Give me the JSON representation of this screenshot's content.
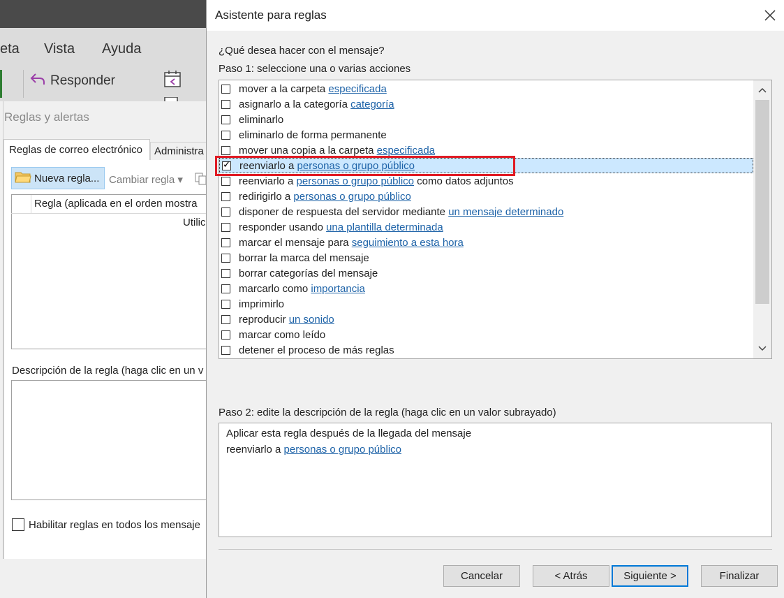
{
  "outlook": {
    "menu": [
      "eta",
      "Vista",
      "Ayuda"
    ],
    "reply_label": "Responder",
    "rules_window_title": "Reglas y alertas",
    "tabs": [
      "Reglas de correo electrónico",
      "Administra"
    ],
    "new_rule_label": "Nueva regla...",
    "change_rule_label": "Cambiar regla",
    "rule_column_header": "Regla (aplicada en el orden mostra",
    "utilic_text": "Utilic",
    "rule_description_label": "Descripción de la regla (haga clic en un v",
    "enable_rules_label": "Habilitar reglas en todos los mensaje"
  },
  "dialog": {
    "title": "Asistente para reglas",
    "question": "¿Qué desea hacer con el mensaje?",
    "step1": "Paso 1: seleccione una o varias acciones",
    "actions": [
      {
        "pre": "mover a la carpeta ",
        "link": "especificada",
        "post": "",
        "checked": false
      },
      {
        "pre": "asignarlo a la categoría ",
        "link": "categoría",
        "post": "",
        "checked": false
      },
      {
        "pre": "eliminarlo",
        "link": "",
        "post": "",
        "checked": false
      },
      {
        "pre": "eliminarlo de forma permanente",
        "link": "",
        "post": "",
        "checked": false
      },
      {
        "pre": "mover una copia a la carpeta ",
        "link": "especificada",
        "post": "",
        "checked": false
      },
      {
        "pre": "reenviarlo a ",
        "link": "personas o grupo público",
        "post": "",
        "checked": true
      },
      {
        "pre": "reenviarlo a ",
        "link": "personas o grupo público",
        "post": " como datos adjuntos",
        "checked": false
      },
      {
        "pre": "redirigirlo a ",
        "link": "personas o grupo público",
        "post": "",
        "checked": false
      },
      {
        "pre": "disponer de respuesta del servidor mediante ",
        "link": "un mensaje determinado",
        "post": "",
        "checked": false
      },
      {
        "pre": "responder usando ",
        "link": "una plantilla determinada",
        "post": "",
        "checked": false
      },
      {
        "pre": "marcar el mensaje para ",
        "link": "seguimiento a esta hora",
        "post": "",
        "checked": false
      },
      {
        "pre": "borrar la marca del mensaje",
        "link": "",
        "post": "",
        "checked": false
      },
      {
        "pre": "borrar categorías del mensaje",
        "link": "",
        "post": "",
        "checked": false
      },
      {
        "pre": "marcarlo como ",
        "link": "importancia",
        "post": "",
        "checked": false
      },
      {
        "pre": "imprimirlo",
        "link": "",
        "post": "",
        "checked": false
      },
      {
        "pre": "reproducir ",
        "link": "un sonido",
        "post": "",
        "checked": false
      },
      {
        "pre": "marcar como leído",
        "link": "",
        "post": "",
        "checked": false
      },
      {
        "pre": "detener el proceso de más reglas",
        "link": "",
        "post": "",
        "checked": false
      }
    ],
    "step2": "Paso 2: edite la descripción de la regla (haga clic en un valor subrayado)",
    "description": {
      "line1": "Aplicar esta regla después de la llegada del mensaje",
      "line2_pre": "reenviarlo a ",
      "line2_link": "personas o grupo público"
    },
    "buttons": {
      "cancel": "Cancelar",
      "back": "< Atrás",
      "next": "Siguiente >",
      "finish": "Finalizar"
    }
  }
}
